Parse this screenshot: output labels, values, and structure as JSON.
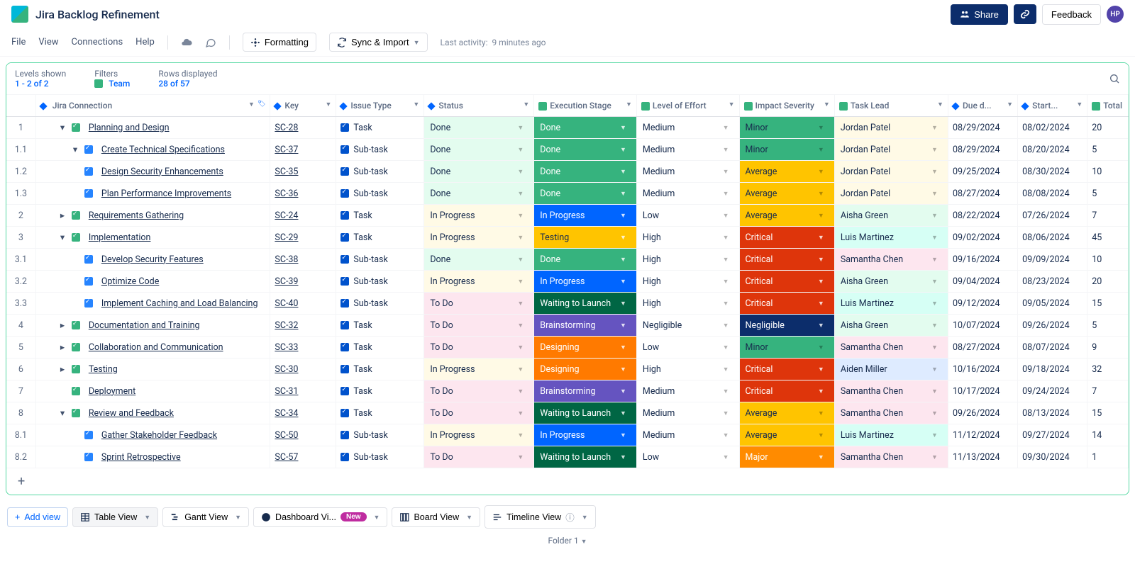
{
  "header": {
    "title": "Jira Backlog Refinement",
    "share": "Share",
    "feedback": "Feedback",
    "avatar_initials": "HP"
  },
  "menubar": {
    "file": "File",
    "view": "View",
    "connections": "Connections",
    "help": "Help",
    "formatting": "Formatting",
    "sync_import": "Sync & Import",
    "last_activity_label": "Last activity:",
    "last_activity_value": "9 minutes ago"
  },
  "controls": {
    "levels_label": "Levels shown",
    "levels_value": "1 - 2 of 2",
    "filters_label": "Filters",
    "filters_value": "Team",
    "rows_label": "Rows displayed",
    "rows_value": "28 of 57"
  },
  "columns": {
    "jira": "Jira Connection",
    "key": "Key",
    "issue_type": "Issue Type",
    "status": "Status",
    "exec_stage": "Execution Stage",
    "effort": "Level of Effort",
    "impact": "Impact Severity",
    "lead": "Task Lead",
    "due": "Due d...",
    "start": "Start...",
    "total": "Total"
  },
  "colors": {
    "done_status_bg": "#e3fcef",
    "inprogress_status_bg": "#fffae6",
    "todo_status_bg": "#fde6ef",
    "exec_done": "#36b37e",
    "exec_inprogress": "#0065ff",
    "exec_testing": "#ffc400",
    "exec_waiting": "#006644",
    "exec_brainstorming": "#6554c0",
    "exec_designing": "#ff7a00",
    "impact_minor": "#36b37e",
    "impact_average": "#ffc400",
    "impact_critical": "#de350b",
    "impact_negligible": "#0c2d6b",
    "impact_major": "#ff8b00",
    "lead_green": "#e3fcef",
    "lead_yellow": "#fffae6",
    "lead_blue": "#deebff",
    "lead_pink": "#fde6ef",
    "lead_teal": "#d6fff5"
  },
  "rows": [
    {
      "num": "1",
      "level": 0,
      "caret": "down",
      "name": "Planning and Design",
      "key": "SC-28",
      "type": "Task",
      "status": "Done",
      "stage": "Done",
      "effort": "Medium",
      "impact": "Minor",
      "lead": "Jordan Patel",
      "lead_bg": "lead_yellow",
      "due": "08/29/2024",
      "start": "08/02/2024",
      "total": "20"
    },
    {
      "num": "1.1",
      "level": 1,
      "caret": "down",
      "name": "Create Technical Specifications",
      "key": "SC-37",
      "type": "Sub-task",
      "status": "Done",
      "stage": "Done",
      "effort": "Medium",
      "impact": "Minor",
      "lead": "Jordan Patel",
      "lead_bg": "lead_yellow",
      "due": "08/29/2024",
      "start": "08/20/2024",
      "total": "5"
    },
    {
      "num": "1.2",
      "level": 1,
      "caret": "",
      "name": "Design Security Enhancements",
      "key": "SC-35",
      "type": "Sub-task",
      "status": "Done",
      "stage": "Done",
      "effort": "Medium",
      "impact": "Average",
      "lead": "Jordan Patel",
      "lead_bg": "lead_yellow",
      "due": "09/25/2024",
      "start": "08/30/2024",
      "total": "10"
    },
    {
      "num": "1.3",
      "level": 1,
      "caret": "",
      "name": "Plan Performance Improvements",
      "key": "SC-36",
      "type": "Sub-task",
      "status": "Done",
      "stage": "Done",
      "effort": "Medium",
      "impact": "Average",
      "lead": "Jordan Patel",
      "lead_bg": "lead_yellow",
      "due": "08/27/2024",
      "start": "08/08/2024",
      "total": "5"
    },
    {
      "num": "2",
      "level": 0,
      "caret": "right",
      "name": "Requirements Gathering",
      "key": "SC-24",
      "type": "Task",
      "status": "In Progress",
      "stage": "In Progress",
      "effort": "Low",
      "impact": "Average",
      "lead": "Aisha Green",
      "lead_bg": "lead_green",
      "due": "08/22/2024",
      "start": "07/26/2024",
      "total": "7"
    },
    {
      "num": "3",
      "level": 0,
      "caret": "down",
      "name": "Implementation",
      "key": "SC-29",
      "type": "Task",
      "status": "In Progress",
      "stage": "Testing",
      "effort": "High",
      "impact": "Critical",
      "lead": "Luis Martinez",
      "lead_bg": "lead_teal",
      "due": "09/02/2024",
      "start": "08/06/2024",
      "total": "45"
    },
    {
      "num": "3.1",
      "level": 1,
      "caret": "",
      "name": "Develop Security Features",
      "key": "SC-38",
      "type": "Sub-task",
      "status": "Done",
      "stage": "Done",
      "effort": "High",
      "impact": "Critical",
      "lead": "Samantha Chen",
      "lead_bg": "lead_pink",
      "due": "09/16/2024",
      "start": "09/09/2024",
      "total": "10"
    },
    {
      "num": "3.2",
      "level": 1,
      "caret": "",
      "name": "Optimize Code",
      "key": "SC-39",
      "type": "Sub-task",
      "status": "In Progress",
      "stage": "In Progress",
      "effort": "High",
      "impact": "Critical",
      "lead": "Aisha Green",
      "lead_bg": "lead_green",
      "due": "09/04/2024",
      "start": "08/23/2024",
      "total": "20"
    },
    {
      "num": "3.3",
      "level": 1,
      "caret": "",
      "name": "Implement Caching and Load Balancing",
      "key": "SC-40",
      "type": "Sub-task",
      "status": "To Do",
      "stage": "Waiting to Launch",
      "effort": "High",
      "impact": "Critical",
      "lead": "Luis Martinez",
      "lead_bg": "lead_teal",
      "due": "09/12/2024",
      "start": "09/05/2024",
      "total": "15"
    },
    {
      "num": "4",
      "level": 0,
      "caret": "right",
      "name": "Documentation and Training",
      "key": "SC-32",
      "type": "Task",
      "status": "To Do",
      "stage": "Brainstorming",
      "effort": "Negligible",
      "impact": "Negligible",
      "lead": "Aisha Green",
      "lead_bg": "lead_green",
      "due": "10/07/2024",
      "start": "09/26/2024",
      "total": "5"
    },
    {
      "num": "5",
      "level": 0,
      "caret": "right",
      "name": "Collaboration and Communication",
      "key": "SC-33",
      "type": "Task",
      "status": "To Do",
      "stage": "Designing",
      "effort": "Low",
      "impact": "Minor",
      "lead": "Samantha Chen",
      "lead_bg": "lead_pink",
      "due": "08/27/2024",
      "start": "08/07/2024",
      "total": "9"
    },
    {
      "num": "6",
      "level": 0,
      "caret": "right",
      "name": "Testing",
      "key": "SC-30",
      "type": "Task",
      "status": "In Progress",
      "stage": "Designing",
      "effort": "High",
      "impact": "Critical",
      "lead": "Aiden Miller",
      "lead_bg": "lead_blue",
      "due": "10/16/2024",
      "start": "09/18/2024",
      "total": "32"
    },
    {
      "num": "7",
      "level": 0,
      "caret": "",
      "name": "Deployment",
      "key": "SC-31",
      "type": "Task",
      "status": "To Do",
      "stage": "Brainstorming",
      "effort": "Medium",
      "impact": "Critical",
      "lead": "Samantha Chen",
      "lead_bg": "lead_pink",
      "due": "10/17/2024",
      "start": "09/24/2024",
      "total": "7"
    },
    {
      "num": "8",
      "level": 0,
      "caret": "down",
      "name": "Review and Feedback",
      "key": "SC-34",
      "type": "Task",
      "status": "To Do",
      "stage": "Waiting to Launch",
      "effort": "Medium",
      "impact": "Average",
      "lead": "Samantha Chen",
      "lead_bg": "lead_pink",
      "due": "09/26/2024",
      "start": "08/13/2024",
      "total": "15"
    },
    {
      "num": "8.1",
      "level": 1,
      "caret": "",
      "name": "Gather Stakeholder Feedback",
      "key": "SC-50",
      "type": "Sub-task",
      "status": "In Progress",
      "stage": "In Progress",
      "effort": "Medium",
      "impact": "Average",
      "lead": "Luis Martinez",
      "lead_bg": "lead_teal",
      "due": "11/12/2024",
      "start": "09/27/2024",
      "total": "14"
    },
    {
      "num": "8.2",
      "level": 1,
      "caret": "",
      "name": "Sprint Retrospective",
      "key": "SC-57",
      "type": "Sub-task",
      "status": "To Do",
      "stage": "Waiting to Launch",
      "effort": "Low",
      "impact": "Major",
      "lead": "Samantha Chen",
      "lead_bg": "lead_pink",
      "due": "11/13/2024",
      "start": "09/30/2024",
      "total": "1"
    }
  ],
  "views": {
    "add": "Add view",
    "table": "Table View",
    "gantt": "Gantt View",
    "dashboard": "Dashboard Vi...",
    "new_badge": "New",
    "board": "Board View",
    "timeline": "Timeline View"
  },
  "folder": "Folder 1"
}
